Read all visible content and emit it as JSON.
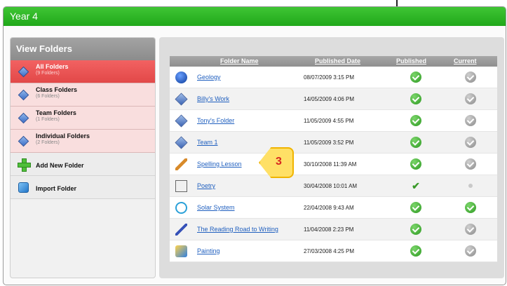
{
  "window": {
    "title": "Year 4"
  },
  "sidebar": {
    "header": "View Folders",
    "items": [
      {
        "label": "All Folders",
        "sub": "(9 Folders)",
        "icon": "all-folders-icon",
        "selected": true
      },
      {
        "label": "Class Folders",
        "sub": "(6 Folders)",
        "icon": "class-folders-icon",
        "selected": false
      },
      {
        "label": "Team Folders",
        "sub": "(1 Folders)",
        "icon": "team-folders-icon",
        "selected": false
      },
      {
        "label": "Individual Folders",
        "sub": "(2 Folders)",
        "icon": "individual-folders-icon",
        "selected": false
      }
    ],
    "actions": [
      {
        "label": "Add New Folder",
        "icon": "plus-icon"
      },
      {
        "label": "Import Folder",
        "icon": "import-icon"
      }
    ]
  },
  "table": {
    "headers": {
      "folder_name": "Folder Name",
      "published_date": "Published Date",
      "published": "Published",
      "current": "Current"
    },
    "rows": [
      {
        "name": "Geology",
        "date": "08/07/2009 3:15 PM",
        "icon": "globe-icon",
        "published": "check-green",
        "current": "check-gray"
      },
      {
        "name": "Billy's Work",
        "date": "14/05/2009 4:06 PM",
        "icon": "folder-diamond-icon",
        "published": "check-green",
        "current": "check-gray"
      },
      {
        "name": "Tony's Folder",
        "date": "11/05/2009 4:55 PM",
        "icon": "folder-diamond-icon",
        "published": "check-green",
        "current": "check-gray"
      },
      {
        "name": "Team 1",
        "date": "11/05/2009 3:52 PM",
        "icon": "folder-diamond-icon",
        "published": "check-green",
        "current": "check-gray"
      },
      {
        "name": "Spelling Lesson",
        "date": "30/10/2008 11:39 AM",
        "icon": "pencil-icon",
        "published": "check-green",
        "current": "check-gray"
      },
      {
        "name": "Poetry",
        "date": "30/04/2008 10:01 AM",
        "icon": "blocks-icon",
        "published": "tick",
        "current": "dot"
      },
      {
        "name": "Solar System",
        "date": "22/04/2008 9:43 AM",
        "icon": "atom-icon",
        "published": "check-green",
        "current": "check-green"
      },
      {
        "name": "The Reading Road to Writing",
        "date": "11/04/2008 2:23 PM",
        "icon": "pen-icon",
        "published": "check-green",
        "current": "check-gray"
      },
      {
        "name": "Painting",
        "date": "27/03/2008 4:25 PM",
        "icon": "paint-icon",
        "published": "check-green",
        "current": "check-gray"
      }
    ]
  },
  "callout": {
    "number": "3"
  }
}
